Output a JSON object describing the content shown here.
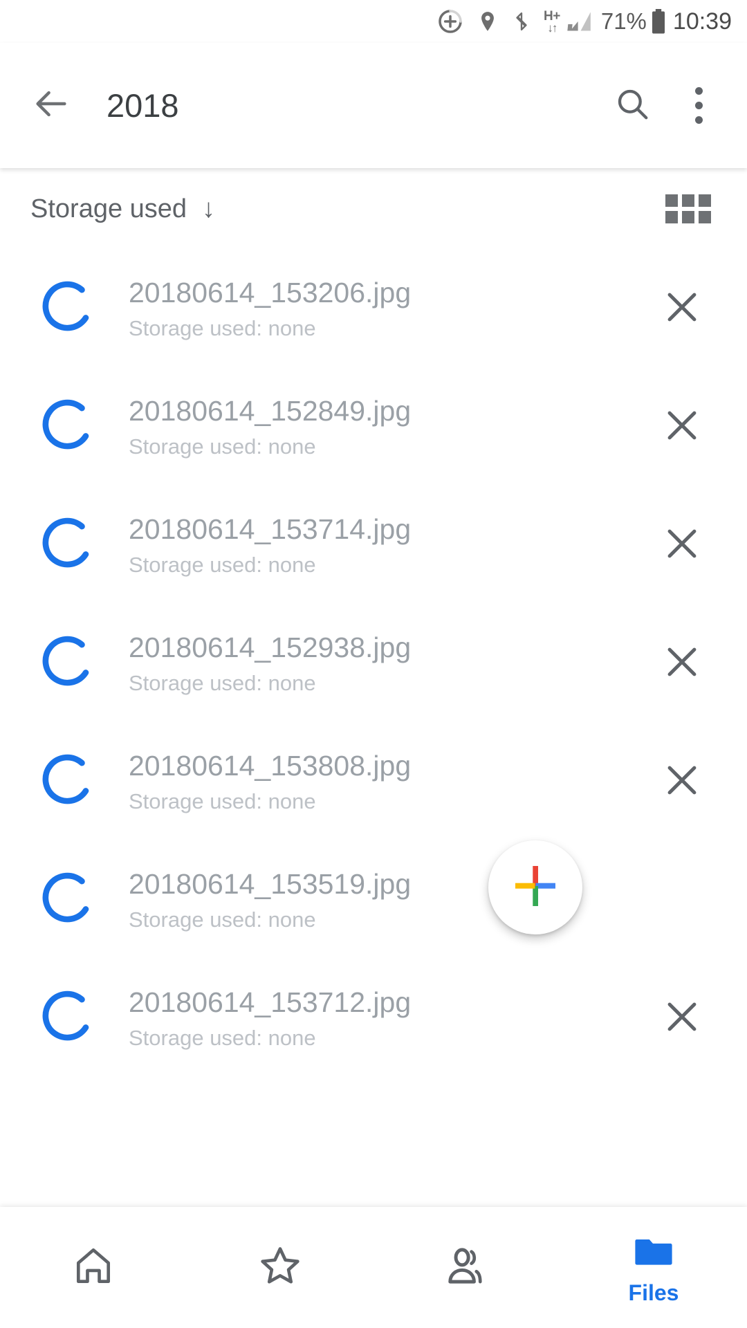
{
  "status_bar": {
    "icons": [
      "sync-progress-icon",
      "location-icon",
      "bluetooth-icon",
      "hplus-data-icon",
      "signal-icon"
    ],
    "data_label": "H+",
    "battery_percent": "71%",
    "time": "10:39"
  },
  "app_bar": {
    "back_icon": "back-arrow-icon",
    "title": "2018",
    "search_icon": "search-icon",
    "overflow_icon": "more-vertical-icon"
  },
  "sort_bar": {
    "label": "Storage used",
    "direction_arrow": "↓",
    "view_toggle_icon": "grid-view-icon"
  },
  "files": [
    {
      "name": "20180614_153206.jpg",
      "storage": "Storage used: none"
    },
    {
      "name": "20180614_152849.jpg",
      "storage": "Storage used: none"
    },
    {
      "name": "20180614_153714.jpg",
      "storage": "Storage used: none"
    },
    {
      "name": "20180614_152938.jpg",
      "storage": "Storage used: none"
    },
    {
      "name": "20180614_153808.jpg",
      "storage": "Storage used: none"
    },
    {
      "name": "20180614_153519.jpg",
      "storage": "Storage used: none"
    },
    {
      "name": "20180614_153712.jpg",
      "storage": "Storage used: none"
    }
  ],
  "fab": {
    "icon": "google-plus-add-icon"
  },
  "bottom_nav": {
    "items": [
      {
        "icon": "home-icon",
        "label": "",
        "active": false
      },
      {
        "icon": "star-icon",
        "label": "",
        "active": false
      },
      {
        "icon": "shared-people-icon",
        "label": "",
        "active": false
      },
      {
        "icon": "folder-icon",
        "label": "Files",
        "active": true
      }
    ]
  },
  "colors": {
    "accent_blue": "#1a73e8",
    "spinner_blue": "#1a73e8",
    "text_primary": "#3c4043",
    "text_secondary": "#9aa0a6",
    "text_tertiary": "#bdc1c6",
    "google_red": "#ea4335",
    "google_yellow": "#fbbc04",
    "google_green": "#34a853",
    "google_blue": "#4285f4"
  }
}
